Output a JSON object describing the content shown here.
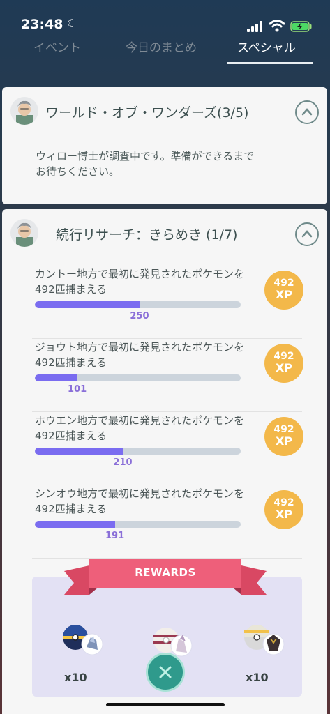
{
  "status_bar": {
    "time": "23:48"
  },
  "tabs": [
    {
      "label": "イベント"
    },
    {
      "label": "今日のまとめ"
    },
    {
      "label": "スペシャル"
    }
  ],
  "research1": {
    "title": "ワールド・オブ・ワンダーズ(3/5)",
    "body": "ウィロー博士が調査中です。準備ができるまでお待ちください。"
  },
  "research2": {
    "title": "続行リサーチ：きらめき (1/7)",
    "tasks": [
      {
        "text": "カントー地方で最初に発見されたポケモンを492匹捕まえる",
        "progress": 250,
        "target": 492,
        "xp_value": "492",
        "xp_unit": "XP"
      },
      {
        "text": "ジョウト地方で最初に発見されたポケモンを492匹捕まえる",
        "progress": 101,
        "target": 492,
        "xp_value": "492",
        "xp_unit": "XP"
      },
      {
        "text": "ホウエン地方で最初に発見されたポケモンを492匹捕まえる",
        "progress": 210,
        "target": 492,
        "xp_value": "492",
        "xp_unit": "XP"
      },
      {
        "text": "シンオウ地方で最初に発見されたポケモンを492匹捕まえる",
        "progress": 191,
        "target": 492,
        "xp_value": "492",
        "xp_unit": "XP"
      }
    ],
    "rewards_label": "REWARDS",
    "rewards": [
      {
        "qty": "x10",
        "icon": "ultra-ball-with-dialga-icon"
      },
      {
        "qty": "",
        "icon": "premier-ball-with-palkia-icon"
      },
      {
        "qty": "x10",
        "icon": "great-ball-with-giratina-icon"
      }
    ]
  },
  "colors": {
    "progress_fill": "#7a6cf0",
    "xp_badge": "#f3b84a",
    "ribbon": "#ee5f7a",
    "close_button": "#2f9a8c"
  }
}
